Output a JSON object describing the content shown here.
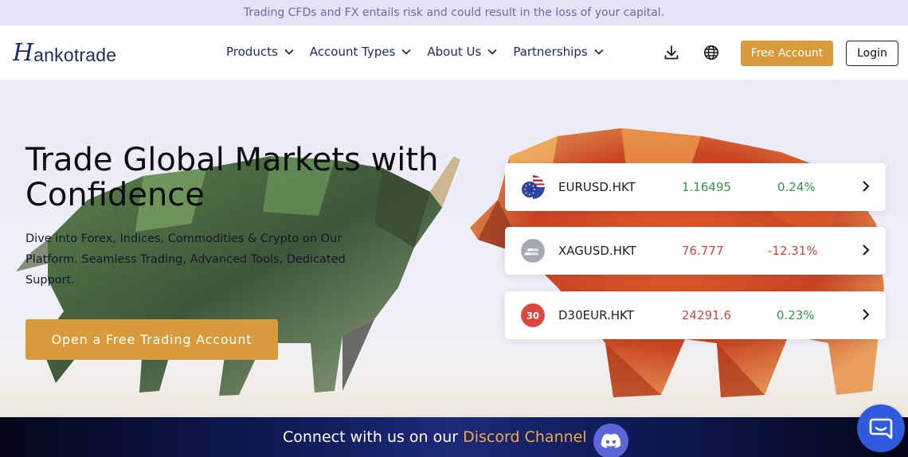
{
  "risk_warning": "Trading CFDs and FX entails risk and could result in the loss of your capital.",
  "brand": {
    "logo_initial": "H",
    "logo_rest": "ankotrade",
    "color": "#1d2b6b"
  },
  "nav": {
    "items": [
      {
        "label": "Products"
      },
      {
        "label": "Account Types"
      },
      {
        "label": "About Us"
      },
      {
        "label": "Partnerships"
      }
    ],
    "download_icon": "download-icon",
    "language_icon": "globe-icon",
    "free_account_label": "Free Account",
    "login_label": "Login"
  },
  "hero": {
    "title": "Trade Global Markets with Confidence",
    "subtitle": "Dive into Forex, Indices, Commodities & Crypto on Our Platform. Seamless Trading, Advanced Tools, Dedicated Support.",
    "cta_label": "Open a Free Trading Account"
  },
  "tickers": [
    {
      "symbol": "EURUSD.HKT",
      "price": "1.16495",
      "change": "0.24%",
      "direction": "up",
      "icon": "eu-us-flag-icon"
    },
    {
      "symbol": "XAGUSD.HKT",
      "price": "76.777",
      "change": "-12.31%",
      "direction": "down",
      "icon": "silver-bars-icon"
    },
    {
      "symbol": "D30EUR.HKT",
      "price": "24291.6",
      "change": "0.23%",
      "direction": "mixed",
      "icon": "d30-badge-icon",
      "icon_text": "30"
    }
  ],
  "discord": {
    "prefix": "Connect with us on our ",
    "highlight": "Discord Channel",
    "icon": "discord-icon"
  },
  "chat_icon": "chat-icon",
  "colors": {
    "accent": "#d89a3b",
    "navy": "#1b2a5e",
    "up": "#2f9a45",
    "down": "#d34545",
    "discord_purple": "#5c66d8",
    "chat_blue": "#2f5bdc"
  }
}
